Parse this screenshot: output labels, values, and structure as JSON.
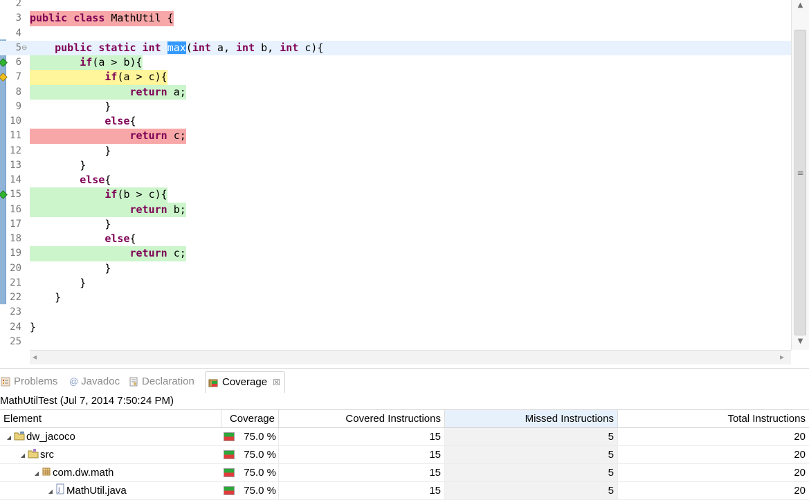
{
  "editor": {
    "lines": [
      {
        "num": "2",
        "segments": [],
        "coverage": "",
        "marker": "",
        "fold": false,
        "current": false
      },
      {
        "num": "3",
        "segments": [
          {
            "t": "public class",
            "kw": true
          },
          {
            "t": " MathUtil {"
          }
        ],
        "coverage": "none",
        "marker": "",
        "fold": false,
        "current": false
      },
      {
        "num": "4",
        "segments": [],
        "coverage": "",
        "marker": "",
        "fold": false,
        "current": false
      },
      {
        "num": "5",
        "segments": [
          {
            "t": "    "
          },
          {
            "t": "public static int",
            "kw": true
          },
          {
            "t": " "
          },
          {
            "t": "max",
            "sel": true
          },
          {
            "t": "("
          },
          {
            "t": "int",
            "kw": true
          },
          {
            "t": " a, "
          },
          {
            "t": "int",
            "kw": true
          },
          {
            "t": " b, "
          },
          {
            "t": "int",
            "kw": true
          },
          {
            "t": " c){"
          }
        ],
        "coverage": "",
        "marker": "",
        "fold": true,
        "current": true
      },
      {
        "num": "6",
        "segments": [
          {
            "t": "        "
          },
          {
            "t": "if",
            "kw": true
          },
          {
            "t": "(a > b){"
          }
        ],
        "coverage": "full",
        "marker": "green",
        "fold": false,
        "current": false
      },
      {
        "num": "7",
        "segments": [
          {
            "t": "            "
          },
          {
            "t": "if",
            "kw": true
          },
          {
            "t": "(a > c){"
          }
        ],
        "coverage": "part",
        "marker": "yellow",
        "fold": false,
        "current": false
      },
      {
        "num": "8",
        "segments": [
          {
            "t": "                "
          },
          {
            "t": "return",
            "kw": true
          },
          {
            "t": " a;"
          }
        ],
        "coverage": "full",
        "marker": "",
        "fold": false,
        "current": false
      },
      {
        "num": "9",
        "segments": [
          {
            "t": "            }"
          }
        ],
        "coverage": "",
        "marker": "",
        "fold": false,
        "current": false
      },
      {
        "num": "10",
        "segments": [
          {
            "t": "            "
          },
          {
            "t": "else",
            "kw": true
          },
          {
            "t": "{"
          }
        ],
        "coverage": "",
        "marker": "",
        "fold": false,
        "current": false
      },
      {
        "num": "11",
        "segments": [
          {
            "t": "                "
          },
          {
            "t": "return",
            "kw": true
          },
          {
            "t": " c;"
          }
        ],
        "coverage": "none",
        "marker": "",
        "fold": false,
        "current": false
      },
      {
        "num": "12",
        "segments": [
          {
            "t": "            }"
          }
        ],
        "coverage": "",
        "marker": "",
        "fold": false,
        "current": false
      },
      {
        "num": "13",
        "segments": [
          {
            "t": "        }"
          }
        ],
        "coverage": "",
        "marker": "",
        "fold": false,
        "current": false
      },
      {
        "num": "14",
        "segments": [
          {
            "t": "        "
          },
          {
            "t": "else",
            "kw": true
          },
          {
            "t": "{"
          }
        ],
        "coverage": "",
        "marker": "",
        "fold": false,
        "current": false
      },
      {
        "num": "15",
        "segments": [
          {
            "t": "            "
          },
          {
            "t": "if",
            "kw": true
          },
          {
            "t": "(b > c){"
          }
        ],
        "coverage": "full",
        "marker": "green",
        "fold": false,
        "current": false
      },
      {
        "num": "16",
        "segments": [
          {
            "t": "                "
          },
          {
            "t": "return",
            "kw": true
          },
          {
            "t": " b;"
          }
        ],
        "coverage": "full",
        "marker": "",
        "fold": false,
        "current": false
      },
      {
        "num": "17",
        "segments": [
          {
            "t": "            }"
          }
        ],
        "coverage": "",
        "marker": "",
        "fold": false,
        "current": false
      },
      {
        "num": "18",
        "segments": [
          {
            "t": "            "
          },
          {
            "t": "else",
            "kw": true
          },
          {
            "t": "{"
          }
        ],
        "coverage": "",
        "marker": "",
        "fold": false,
        "current": false
      },
      {
        "num": "19",
        "segments": [
          {
            "t": "                "
          },
          {
            "t": "return",
            "kw": true
          },
          {
            "t": " c;"
          }
        ],
        "coverage": "full",
        "marker": "",
        "fold": false,
        "current": false
      },
      {
        "num": "20",
        "segments": [
          {
            "t": "            }"
          }
        ],
        "coverage": "",
        "marker": "",
        "fold": false,
        "current": false
      },
      {
        "num": "21",
        "segments": [
          {
            "t": "        }"
          }
        ],
        "coverage": "",
        "marker": "",
        "fold": false,
        "current": false
      },
      {
        "num": "22",
        "segments": [
          {
            "t": "    }"
          }
        ],
        "coverage": "",
        "marker": "",
        "fold": false,
        "current": false
      },
      {
        "num": "23",
        "segments": [],
        "coverage": "",
        "marker": "",
        "fold": false,
        "current": false
      },
      {
        "num": "24",
        "segments": [
          {
            "t": "}"
          }
        ],
        "coverage": "",
        "marker": "",
        "fold": false,
        "current": false
      },
      {
        "num": "25",
        "segments": [],
        "coverage": "",
        "marker": "",
        "fold": false,
        "current": false
      }
    ]
  },
  "panel": {
    "tabs": [
      {
        "label": "Problems",
        "icon": "problems-icon",
        "active": false
      },
      {
        "label": "Javadoc",
        "icon": "javadoc-icon",
        "active": false
      },
      {
        "label": "Declaration",
        "icon": "declaration-icon",
        "active": false
      },
      {
        "label": "Coverage",
        "icon": "coverage-icon",
        "active": true
      }
    ],
    "close_glyph": "☒",
    "session": "MathUtilTest (Jul 7, 2014 7:50:24 PM)",
    "columns": {
      "element": "Element",
      "coverage": "Coverage",
      "covered": "Covered Instructions",
      "missed": "Missed Instructions",
      "total": "Total Instructions"
    },
    "rows": [
      {
        "name": "dw_jacoco",
        "icon": "project-folder-icon",
        "coverage": "75.0 %",
        "covered": "15",
        "missed": "5",
        "total": "20"
      },
      {
        "name": "src",
        "icon": "source-folder-icon",
        "coverage": "75.0 %",
        "covered": "15",
        "missed": "5",
        "total": "20"
      },
      {
        "name": "com.dw.math",
        "icon": "package-icon",
        "coverage": "75.0 %",
        "covered": "15",
        "missed": "5",
        "total": "20"
      },
      {
        "name": "MathUtil.java",
        "icon": "java-file-icon",
        "coverage": "75.0 %",
        "covered": "15",
        "missed": "5",
        "total": "20"
      }
    ]
  },
  "colors": {
    "covered": "#ccf5cc",
    "missed": "#f7a7a7",
    "partial": "#fff59b",
    "keyword": "#7f0055",
    "selection": "#3399ff",
    "marker_green": "#2fb52f",
    "marker_yellow": "#f0c020"
  }
}
